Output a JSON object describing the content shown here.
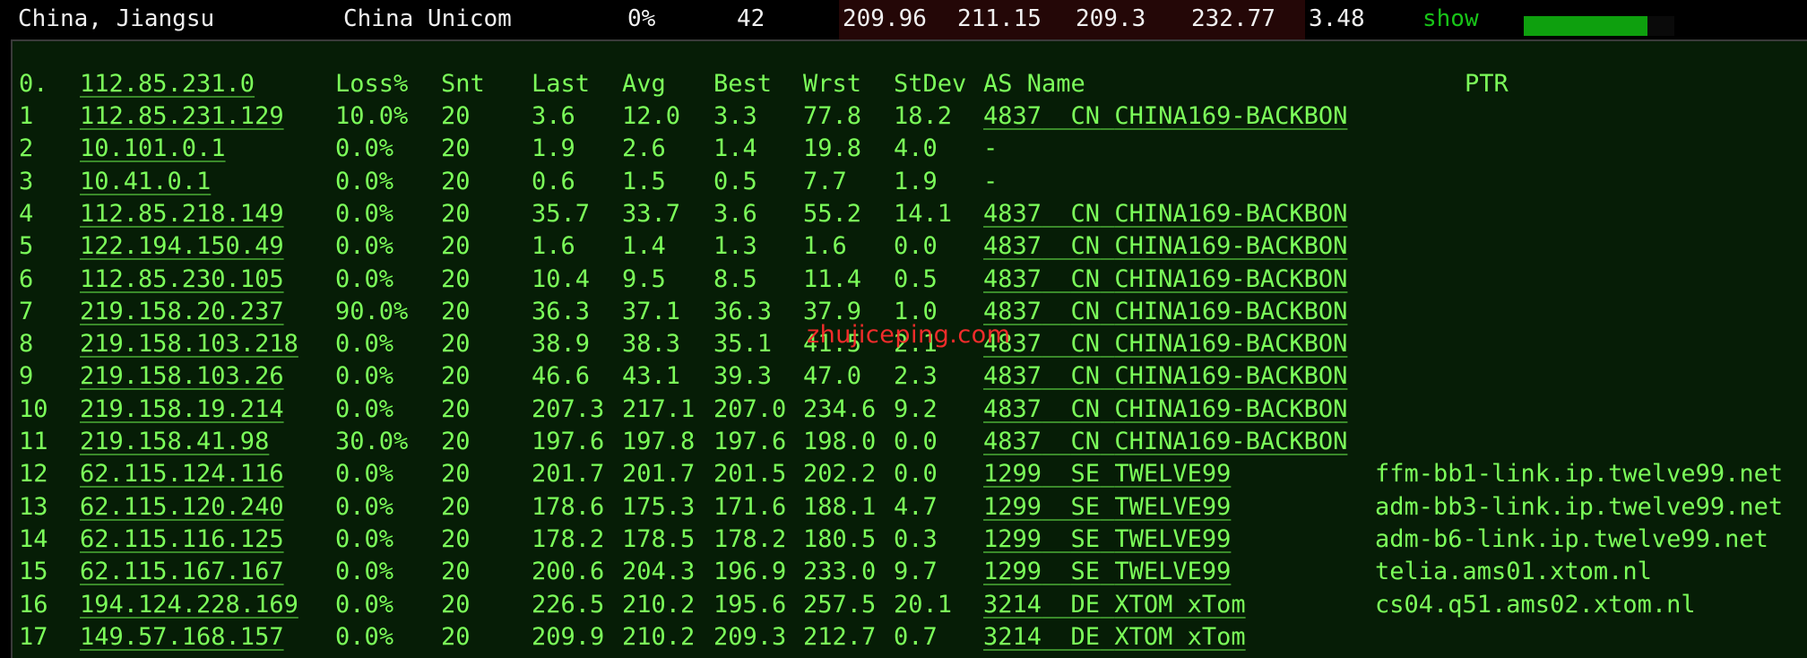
{
  "summary": {
    "location": "China, Jiangsu",
    "provider": "China Unicom",
    "loss": "0%",
    "count": "42",
    "last": "209.96",
    "avg": "211.15",
    "best": "209.3",
    "worst": "232.77",
    "stdev": "3.48",
    "show_label": "show",
    "latency_bar_fraction": 0.82,
    "shade_color": "#240707",
    "bar_color": "#0ea00e"
  },
  "table": {
    "header": {
      "hop": "0.",
      "ip": "112.85.231.0",
      "loss": "Loss%",
      "snt": "Snt",
      "last": "Last",
      "avg": "Avg",
      "best": "Best",
      "wrst": "Wrst",
      "stdev": "StDev",
      "as_name": "AS Name",
      "ptr": "PTR"
    },
    "rows": [
      {
        "hop": "1",
        "ip": "112.85.231.129",
        "loss": "10.0%",
        "snt": "20",
        "last": "3.6",
        "avg": "12.0",
        "best": "3.3",
        "wrst": "77.8",
        "stdev": "18.2",
        "asn": "4837",
        "cc": "CN",
        "name": "CHINA169-BACKBON",
        "ptr": ""
      },
      {
        "hop": "2",
        "ip": "10.101.0.1",
        "loss": "0.0%",
        "snt": "20",
        "last": "1.9",
        "avg": "2.6",
        "best": "1.4",
        "wrst": "19.8",
        "stdev": "4.0",
        "asn": "-",
        "cc": "",
        "name": "",
        "ptr": ""
      },
      {
        "hop": "3",
        "ip": "10.41.0.1",
        "loss": "0.0%",
        "snt": "20",
        "last": "0.6",
        "avg": "1.5",
        "best": "0.5",
        "wrst": "7.7",
        "stdev": "1.9",
        "asn": "-",
        "cc": "",
        "name": "",
        "ptr": ""
      },
      {
        "hop": "4",
        "ip": "112.85.218.149",
        "loss": "0.0%",
        "snt": "20",
        "last": "35.7",
        "avg": "33.7",
        "best": "3.6",
        "wrst": "55.2",
        "stdev": "14.1",
        "asn": "4837",
        "cc": "CN",
        "name": "CHINA169-BACKBON",
        "ptr": ""
      },
      {
        "hop": "5",
        "ip": "122.194.150.49",
        "loss": "0.0%",
        "snt": "20",
        "last": "1.6",
        "avg": "1.4",
        "best": "1.3",
        "wrst": "1.6",
        "stdev": "0.0",
        "asn": "4837",
        "cc": "CN",
        "name": "CHINA169-BACKBON",
        "ptr": ""
      },
      {
        "hop": "6",
        "ip": "112.85.230.105",
        "loss": "0.0%",
        "snt": "20",
        "last": "10.4",
        "avg": "9.5",
        "best": "8.5",
        "wrst": "11.4",
        "stdev": "0.5",
        "asn": "4837",
        "cc": "CN",
        "name": "CHINA169-BACKBON",
        "ptr": ""
      },
      {
        "hop": "7",
        "ip": "219.158.20.237",
        "loss": "90.0%",
        "snt": "20",
        "last": "36.3",
        "avg": "37.1",
        "best": "36.3",
        "wrst": "37.9",
        "stdev": "1.0",
        "asn": "4837",
        "cc": "CN",
        "name": "CHINA169-BACKBON",
        "ptr": ""
      },
      {
        "hop": "8",
        "ip": "219.158.103.218",
        "loss": "0.0%",
        "snt": "20",
        "last": "38.9",
        "avg": "38.3",
        "best": "35.1",
        "wrst": "41.5",
        "stdev": "2.1",
        "asn": "4837",
        "cc": "CN",
        "name": "CHINA169-BACKBON",
        "ptr": ""
      },
      {
        "hop": "9",
        "ip": "219.158.103.26",
        "loss": "0.0%",
        "snt": "20",
        "last": "46.6",
        "avg": "43.1",
        "best": "39.3",
        "wrst": "47.0",
        "stdev": "2.3",
        "asn": "4837",
        "cc": "CN",
        "name": "CHINA169-BACKBON",
        "ptr": ""
      },
      {
        "hop": "10",
        "ip": "219.158.19.214",
        "loss": "0.0%",
        "snt": "20",
        "last": "207.3",
        "avg": "217.1",
        "best": "207.0",
        "wrst": "234.6",
        "stdev": "9.2",
        "asn": "4837",
        "cc": "CN",
        "name": "CHINA169-BACKBON",
        "ptr": ""
      },
      {
        "hop": "11",
        "ip": "219.158.41.98",
        "loss": "30.0%",
        "snt": "20",
        "last": "197.6",
        "avg": "197.8",
        "best": "197.6",
        "wrst": "198.0",
        "stdev": "0.0",
        "asn": "4837",
        "cc": "CN",
        "name": "CHINA169-BACKBON",
        "ptr": ""
      },
      {
        "hop": "12",
        "ip": "62.115.124.116",
        "loss": "0.0%",
        "snt": "20",
        "last": "201.7",
        "avg": "201.7",
        "best": "201.5",
        "wrst": "202.2",
        "stdev": "0.0",
        "asn": "1299",
        "cc": "SE",
        "name": "TWELVE99",
        "ptr": "ffm-bb1-link.ip.twelve99.net"
      },
      {
        "hop": "13",
        "ip": "62.115.120.240",
        "loss": "0.0%",
        "snt": "20",
        "last": "178.6",
        "avg": "175.3",
        "best": "171.6",
        "wrst": "188.1",
        "stdev": "4.7",
        "asn": "1299",
        "cc": "SE",
        "name": "TWELVE99",
        "ptr": "adm-bb3-link.ip.twelve99.net"
      },
      {
        "hop": "14",
        "ip": "62.115.116.125",
        "loss": "0.0%",
        "snt": "20",
        "last": "178.2",
        "avg": "178.5",
        "best": "178.2",
        "wrst": "180.5",
        "stdev": "0.3",
        "asn": "1299",
        "cc": "SE",
        "name": "TWELVE99",
        "ptr": "adm-b6-link.ip.twelve99.net"
      },
      {
        "hop": "15",
        "ip": "62.115.167.167",
        "loss": "0.0%",
        "snt": "20",
        "last": "200.6",
        "avg": "204.3",
        "best": "196.9",
        "wrst": "233.0",
        "stdev": "9.7",
        "asn": "1299",
        "cc": "SE",
        "name": "TWELVE99",
        "ptr": "telia.ams01.xtom.nl"
      },
      {
        "hop": "16",
        "ip": "194.124.228.169",
        "loss": "0.0%",
        "snt": "20",
        "last": "226.5",
        "avg": "210.2",
        "best": "195.6",
        "wrst": "257.5",
        "stdev": "20.1",
        "asn": "3214",
        "cc": "DE",
        "name": "XTOM xTom",
        "ptr": "cs04.q51.ams02.xtom.nl"
      },
      {
        "hop": "17",
        "ip": "149.57.168.157",
        "loss": "0.0%",
        "snt": "20",
        "last": "209.9",
        "avg": "210.2",
        "best": "209.3",
        "wrst": "212.7",
        "stdev": "0.7",
        "asn": "3214",
        "cc": "DE",
        "name": "XTOM xTom",
        "ptr": ""
      }
    ]
  },
  "watermark": "zhujiceping.com",
  "colors": {
    "text": "#7cff5a",
    "panel_bg": "#061d06",
    "watermark": "#ff2d2d"
  }
}
